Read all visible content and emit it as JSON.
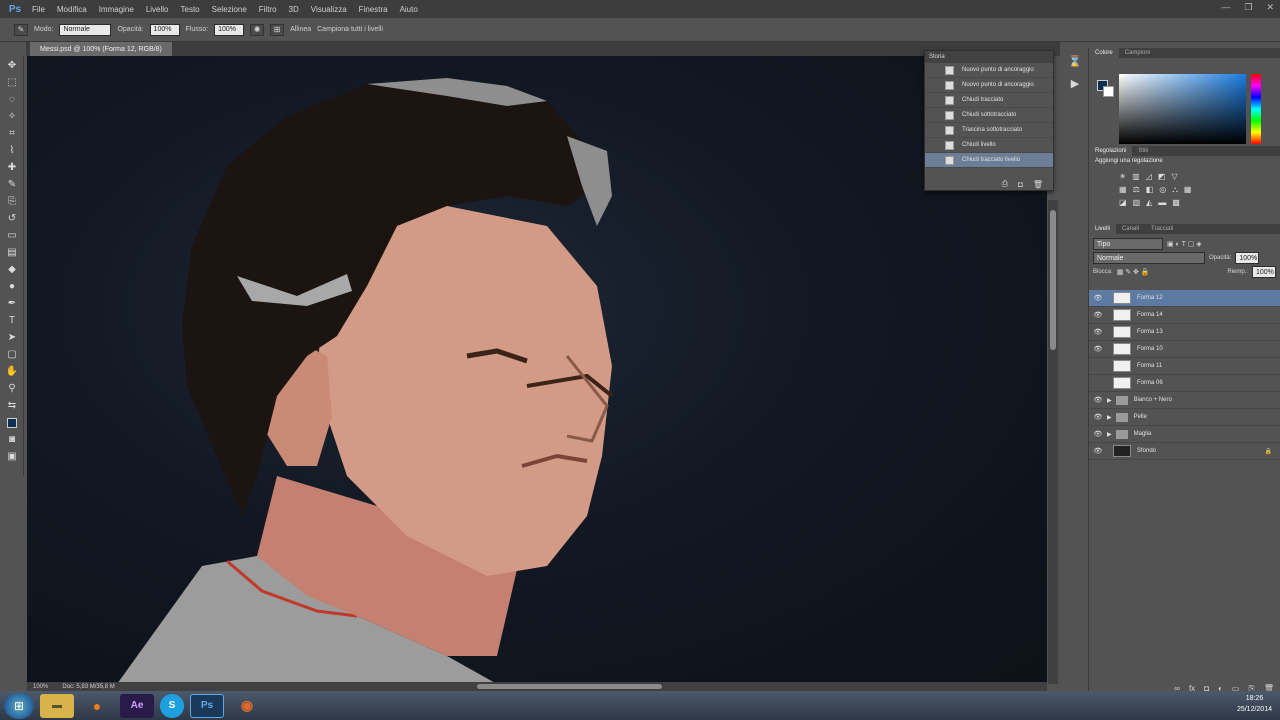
{
  "app": {
    "logo": "Ps"
  },
  "menu": [
    "File",
    "Modifica",
    "Immagine",
    "Livello",
    "Testo",
    "Selezione",
    "Filtro",
    "3D",
    "Visualizza",
    "Finestra",
    "Aiuto"
  ],
  "window_controls": [
    "—",
    "❐",
    "✕"
  ],
  "options_bar": {
    "brush_mode": "Normale",
    "mode_label": "Modo:",
    "opacity_label": "Opacità:",
    "opacity_value": "100%",
    "flow_label": "Flusso:",
    "flow_value": "100%",
    "smoothing_label": "Allinea",
    "sample_label": "Campiona tutti i livelli"
  },
  "document": {
    "tab_title": "Messi.psd @ 100% (Forma 12, RGB/8)",
    "zoom": "100%",
    "doc_info": "Doc: 5,93 M/35,8 M"
  },
  "history": {
    "title": "Storia",
    "items": [
      "Nuovo punto di ancoraggio",
      "Nuovo punto di ancoraggio",
      "Chiudi tracciato",
      "Chiudi sottotracciato",
      "Trascina sottotracciato",
      "Chiudi livello",
      "Chiudi tracciato livello"
    ],
    "selected_index": 6
  },
  "color_panel": {
    "tabs": [
      "Colore",
      "Campioni"
    ],
    "fg_color": "#0e2f52",
    "bg_color": "#ffffff"
  },
  "adjustments": {
    "tabs": [
      "Regolazioni",
      "Stili"
    ],
    "heading": "Aggiungi una regolazione"
  },
  "layers": {
    "tabs": [
      "Livelli",
      "Canali",
      "Tracciati"
    ],
    "filter": "Tipo",
    "blend_mode": "Normale",
    "opacity_label": "Opacità:",
    "opacity": "100%",
    "lock_label": "Blocca:",
    "fill_label": "Riemp.:",
    "fill": "100%",
    "items": [
      {
        "name": "Forma 12",
        "kind": "shape",
        "selected": true
      },
      {
        "name": "Forma 14",
        "kind": "shape",
        "selected": false
      },
      {
        "name": "Forma 13",
        "kind": "shape",
        "selected": false
      },
      {
        "name": "Forma 10",
        "kind": "shape",
        "selected": false
      },
      {
        "name": "Forma 11",
        "kind": "shape",
        "selected": false
      },
      {
        "name": "Forma 06",
        "kind": "shape",
        "selected": false
      },
      {
        "name": "Bianco + Nero",
        "kind": "group",
        "selected": false
      },
      {
        "name": "Pelle",
        "kind": "group",
        "selected": false
      },
      {
        "name": "Maglia",
        "kind": "group",
        "selected": false
      },
      {
        "name": "Sfondo",
        "kind": "background",
        "selected": false
      }
    ]
  },
  "taskbar": {
    "apps": [
      "Explorer",
      "Firefox",
      "Ae",
      "Skype",
      "Ps",
      "Paint"
    ],
    "time": "18:26",
    "date": "25/12/2014"
  }
}
